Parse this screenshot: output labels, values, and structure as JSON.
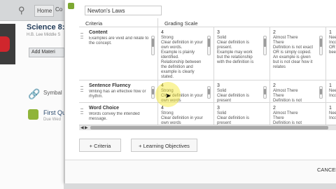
{
  "topbar": {
    "search_icon": "search-icon",
    "home": "Home",
    "courses_truncated": "Co"
  },
  "course": {
    "title": "Science 8:",
    "subtitle": "H.B. Lee Middle S",
    "add_materials": "Add Materi",
    "items": [
      {
        "icon": "link-icon",
        "label": "Symbal"
      },
      {
        "icon": "puzzle-icon",
        "label": "First Qu",
        "sub": "Due Wed"
      }
    ]
  },
  "modal": {
    "title_value": "Newton's Laws",
    "headers": {
      "criteria": "Criteria",
      "grading_scale": "Grading Scale"
    },
    "rows": [
      {
        "name": "Content",
        "desc": "Examples are vivid and relate to the concept.",
        "levels": [
          {
            "pts": "4",
            "text": "Strong\nClear definition in your own words.\nExample is plainly identified.\nRelationship between the definition and example is clearly stated."
          },
          {
            "pts": "3",
            "text": "Solid\nClear definition is present.\nExample may work but the relationship with the definition is"
          },
          {
            "pts": "2",
            "text": "Almost There\nThere\nDefinition is not exact OR is simply copied. An example is given but is not clear how it relates"
          },
          {
            "pts": "1",
            "text": "Nee\nIncor\nOR n\nbeen"
          }
        ]
      },
      {
        "name": "Sentence Fluency",
        "desc": "Writing has an effective flow or rhythm.",
        "levels": [
          {
            "pts": "4",
            "text": "Strong\nClear definition in your own words"
          },
          {
            "pts": "3",
            "text": "Solid\nClear definition is present"
          },
          {
            "pts": "2",
            "text": "Almost There\nThere\nDefinition is not"
          },
          {
            "pts": "1",
            "text": "Nee\nIncor"
          }
        ]
      },
      {
        "name": "Word Choice",
        "desc": "Words convey the intended message.",
        "levels": [
          {
            "pts": "4",
            "text": "Strong\nClear definition in your own words"
          },
          {
            "pts": "3",
            "text": "Solid\nClear definition is present"
          },
          {
            "pts": "2",
            "text": "Almost There\nThere\nDefinition is not"
          },
          {
            "pts": "1",
            "text": "Nee\nIncor"
          }
        ]
      }
    ],
    "buttons": {
      "criteria": "+ Criteria",
      "objectives": "+ Learning Objectives",
      "cancel": "CANCEL"
    }
  }
}
